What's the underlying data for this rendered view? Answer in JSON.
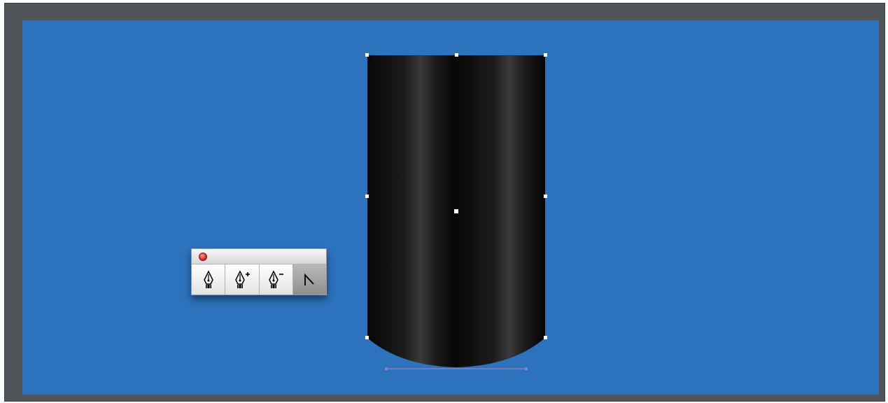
{
  "colors": {
    "frame": "#4f5559",
    "canvas": "#2d72bd",
    "shape_dark": "#0b0b0b",
    "shape_highlight": "#3a3a3a",
    "anchor": "#ffffff",
    "handle_line": "#8a7fb8",
    "close_button": "#e0312f"
  },
  "tool_panel": {
    "tools": [
      {
        "name": "pen-tool",
        "icon": "pen-icon",
        "selected": false
      },
      {
        "name": "add-anchor-point-tool",
        "icon": "pen-plus-icon",
        "selected": false
      },
      {
        "name": "delete-anchor-point-tool",
        "icon": "pen-minus-icon",
        "selected": false
      },
      {
        "name": "convert-anchor-point-tool",
        "icon": "convert-anchor-icon",
        "selected": true
      }
    ]
  }
}
